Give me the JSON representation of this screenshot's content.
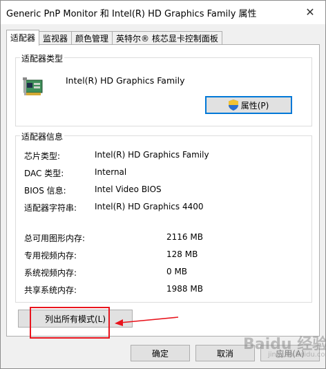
{
  "window": {
    "title": "Generic PnP Monitor 和 Intel(R) HD Graphics Family 属性"
  },
  "tabs": [
    {
      "label": "适配器"
    },
    {
      "label": "监视器"
    },
    {
      "label": "颜色管理"
    },
    {
      "label": "英特尔® 核芯显卡控制面板"
    }
  ],
  "adapter_type": {
    "group_label": "适配器类型",
    "name": "Intel(R) HD Graphics Family",
    "properties_button": "属性(P)"
  },
  "adapter_info": {
    "group_label": "适配器信息",
    "rows": [
      {
        "label": "芯片类型:",
        "value": "Intel(R) HD Graphics Family"
      },
      {
        "label": "DAC 类型:",
        "value": "Internal"
      },
      {
        "label": "BIOS 信息:",
        "value": "Intel Video BIOS"
      },
      {
        "label": "适配器字符串:",
        "value": "Intel(R) HD Graphics 4400"
      }
    ],
    "memory_rows": [
      {
        "label": "总可用图形内存:",
        "value": "2116 MB"
      },
      {
        "label": "专用视频内存:",
        "value": "128 MB"
      },
      {
        "label": "系统视频内存:",
        "value": "0 MB"
      },
      {
        "label": "共享系统内存:",
        "value": "1988 MB"
      }
    ]
  },
  "list_modes_button": "列出所有模式(L)",
  "footer": {
    "ok": "确定",
    "cancel": "取消",
    "apply": "应用(A)"
  },
  "watermark": {
    "main": "Baidu 经验",
    "sub": "jingyan.baidu.com"
  },
  "colors": {
    "accent": "#0078d7",
    "annotation_red": "#e8141d"
  }
}
